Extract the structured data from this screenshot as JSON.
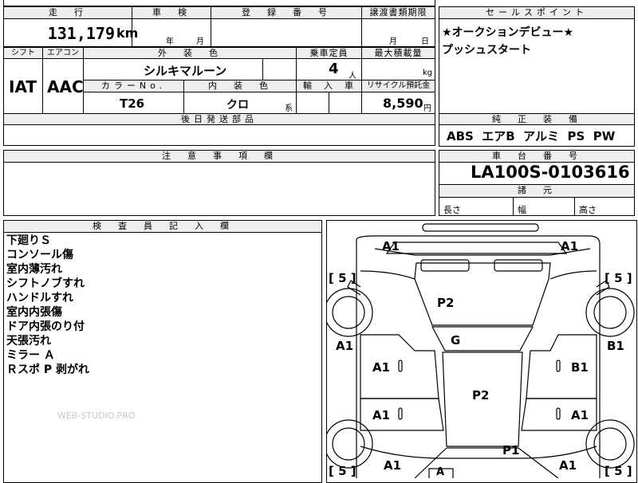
{
  "top_row": {
    "mileage_header": "走　行",
    "mileage_value": "131,179",
    "mileage_unit": "km",
    "inspection_header": "車　検",
    "inspection_year": "年",
    "inspection_month": "月",
    "registration_header": "登　録　番　号",
    "transfer_header": "譲渡書類期限",
    "transfer_month": "月",
    "transfer_day": "日",
    "sales_point_header": "セールスポイント",
    "sales_point_line1": "★オークションデビュー★",
    "sales_point_line2": "プッシュスタート"
  },
  "spec_row": {
    "shift_header": "シフト",
    "ac_header": "エアコン",
    "exterior_color_header": "外　装　色",
    "capacity_header": "乗車定員",
    "max_load_header": "最大積載量",
    "shift_value": "IAT",
    "ac_value": "AAC",
    "exterior_color_value": "シルキマルーン",
    "capacity_value": "4",
    "capacity_unit": "人",
    "max_load_unit": "kg",
    "color_no_header": "カラーNo.",
    "interior_color_header": "内　装　色",
    "import_header": "輸　入　車",
    "recycle_header": "リサイクル預託金",
    "color_no_value": "T26",
    "interior_color_value": "クロ",
    "interior_color_suffix": "系",
    "recycle_value": "8,590",
    "recycle_unit": "円",
    "later_parts_header": "後日発送部品"
  },
  "equipment": {
    "header": "純　正　装　備",
    "items": "ABS  エアB  アルミ  PS  PW"
  },
  "caution": {
    "header": "注　意　事　項　欄"
  },
  "chassis": {
    "header": "車　台　番　号",
    "number": "LA100S-0103616",
    "dims_header": "諸　元",
    "length_label": "長さ",
    "width_label": "幅",
    "height_label": "高さ"
  },
  "inspector": {
    "header": "検　査　員　記　入　欄",
    "notes": [
      "下廻りＳ",
      "コンソール傷",
      "室内薄汚れ",
      "シフトノブすれ",
      "ハンドルすれ",
      "室内内張傷",
      "ドア内張のり付",
      "天張汚れ",
      "ミラー Ａ",
      "Ｒスポ P 剥がれ"
    ],
    "watermark": "WEB-STUDIO.PRO"
  },
  "diagram": {
    "tire_fl": "[ 5 ]",
    "tire_fr": "[ 5 ]",
    "tire_rl": "[ 5 ]",
    "tire_rr": "[ 5 ]",
    "corner_fl": "A1",
    "corner_fr": "A1",
    "hood": "P2",
    "fender_l": "A1",
    "fender_r": "B1",
    "windshield": "G",
    "door_fl": "A1",
    "door_fr": "B1",
    "roof": "P2",
    "door_rl": "A1",
    "door_rr": "A1",
    "trunk": "P1",
    "corner_rl": "A1",
    "corner_rr": "A1",
    "rear_mark": "A"
  }
}
